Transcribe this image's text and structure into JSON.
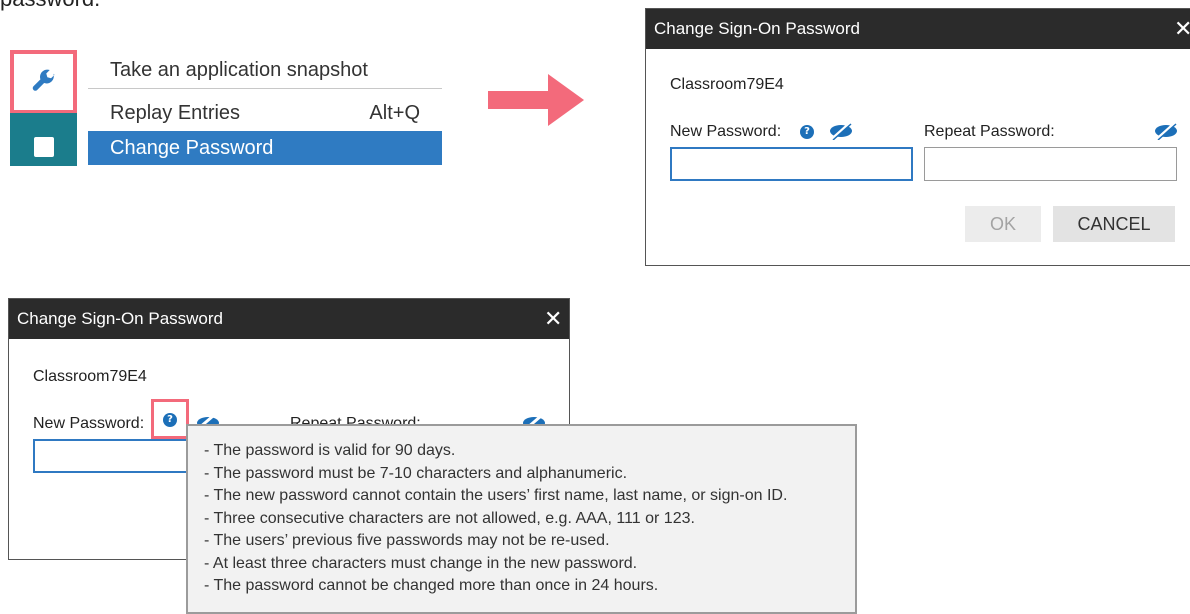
{
  "top_fragment": "password.",
  "menu": {
    "items": [
      {
        "label": "Take an application snapshot",
        "shortcut": ""
      },
      {
        "label": "Replay Entries",
        "shortcut": "Alt+Q"
      },
      {
        "label": "Change Password",
        "shortcut": ""
      }
    ],
    "selected_index": 2
  },
  "dialog": {
    "title": "Change Sign-On Password",
    "close_glyph": "✕",
    "account_id": "Classroom79E4",
    "new_password_label": "New Password:",
    "repeat_password_label": "Repeat Password:",
    "new_password_value": "",
    "repeat_password_value": "",
    "ok_label": "OK",
    "cancel_label": "CANCEL"
  },
  "dialog_partial": {
    "repeat_password_label_partial": "Repeat Password:"
  },
  "tooltip": {
    "rules": [
      "- The password is valid for 90 days.",
      "- The password must be 7-10 characters and alphanumeric.",
      "- The new password cannot contain the users’ first name, last name, or sign-on ID.",
      "- Three consecutive characters are not allowed, e.g. AAA, 111 or 123.",
      "- The users’ previous five passwords may not be re-used.",
      "- At least three characters must change in the new password.",
      "- The password cannot be changed more than once in 24 hours."
    ]
  },
  "colors": {
    "highlight": "#f36a7b",
    "titlebar": "#2b2b2b",
    "selected": "#2f7bc2",
    "teal": "#1b7d8c",
    "info": "#1c6fb8"
  }
}
